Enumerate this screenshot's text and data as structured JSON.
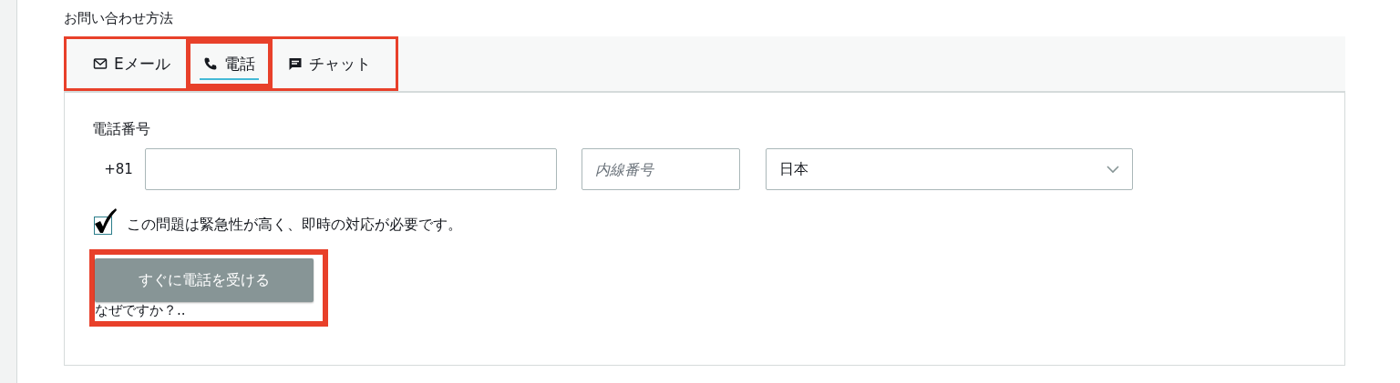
{
  "section_label": "お問い合わせ方法",
  "tabs_highlighted": true,
  "tabs": [
    {
      "label": "Eメール",
      "kind": "mail",
      "selected": false,
      "highlighted": false
    },
    {
      "label": "電話",
      "kind": "phone",
      "selected": true,
      "highlighted": true
    },
    {
      "label": "チャット",
      "kind": "chat",
      "selected": false,
      "highlighted": false
    }
  ],
  "phone": {
    "label": "電話番号",
    "country_code": "+81",
    "extension": {
      "placeholder": "内線番号"
    },
    "country": {
      "value": "日本"
    }
  },
  "urgent": {
    "label": "この問題は緊急性が高く、即時の対応が必要です。",
    "checked": true
  },
  "action": {
    "button": "すぐに電話を受ける",
    "disabled": true,
    "link": "なぜですか？..",
    "highlighted": true
  }
}
